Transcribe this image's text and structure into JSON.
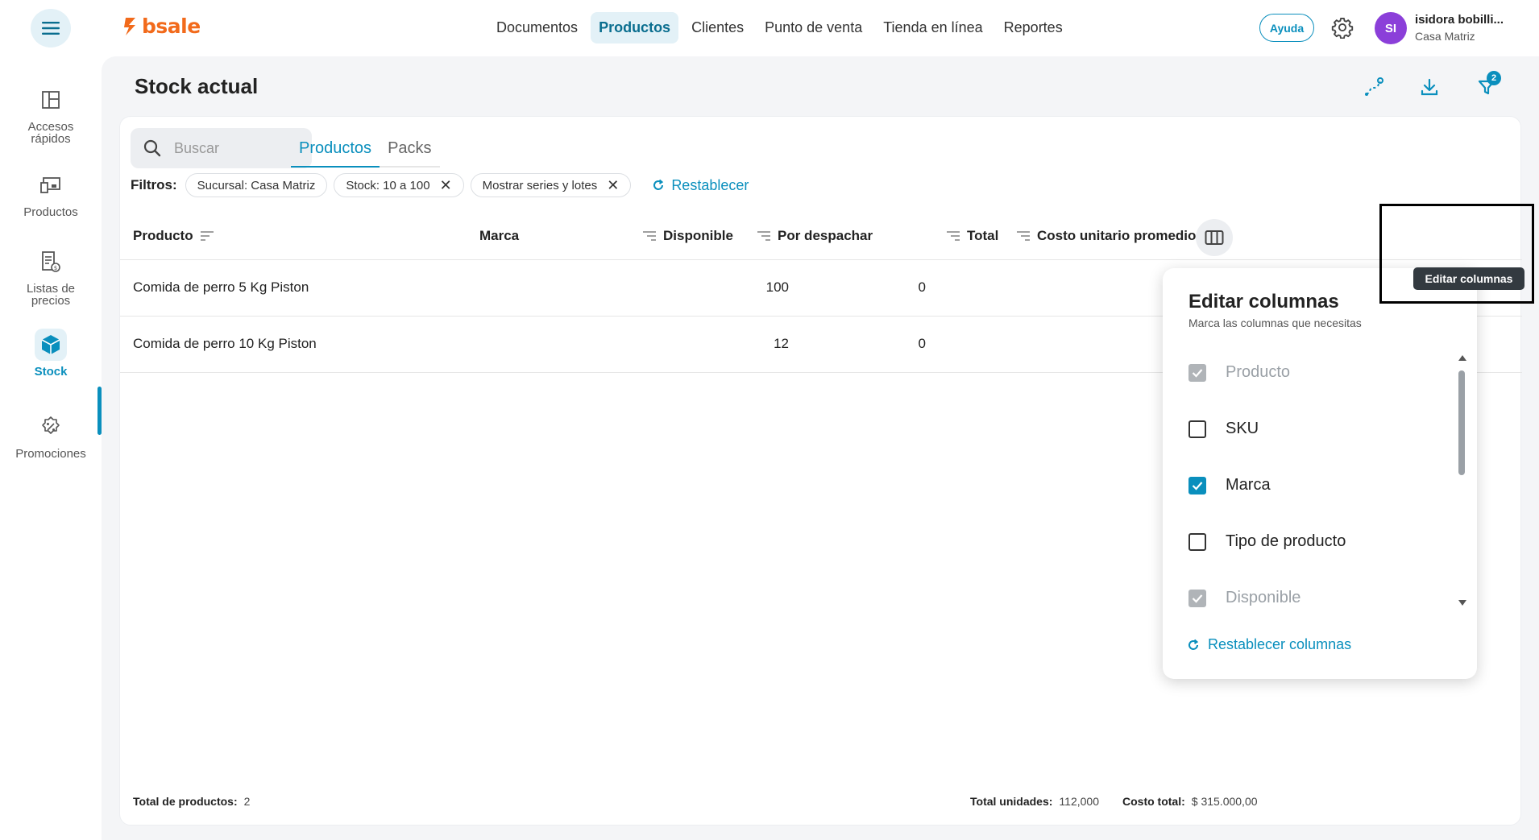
{
  "brand": {
    "name": "bsale",
    "color": "#f26a1b",
    "accent": "#0a8fbd"
  },
  "topnav": {
    "items": [
      {
        "label": "Documentos",
        "active": false
      },
      {
        "label": "Productos",
        "active": true
      },
      {
        "label": "Clientes",
        "active": false
      },
      {
        "label": "Punto de venta",
        "active": false
      },
      {
        "label": "Tienda en línea",
        "active": false
      },
      {
        "label": "Reportes",
        "active": false
      }
    ],
    "help_label": "Ayuda",
    "user": {
      "initials": "SI",
      "name": "isidora bobilli...",
      "branch": "Casa Matriz"
    }
  },
  "sidebar": {
    "items": [
      {
        "label_line1": "Accesos",
        "label_line2": "rápidos",
        "icon": "layout-icon"
      },
      {
        "label_line1": "Productos",
        "label_line2": "",
        "icon": "devices-icon"
      },
      {
        "label_line1": "Listas de",
        "label_line2": "precios",
        "icon": "price-list-icon"
      },
      {
        "label_line1": "Stock",
        "label_line2": "",
        "icon": "box-icon",
        "active": true
      },
      {
        "label_line1": "Promociones",
        "label_line2": "",
        "icon": "percent-badge-icon"
      }
    ]
  },
  "page": {
    "title": "Stock actual",
    "filter_badge_count": "2"
  },
  "search": {
    "placeholder": "Buscar",
    "value": ""
  },
  "tabs": [
    {
      "label": "Productos",
      "active": true
    },
    {
      "label": "Packs",
      "active": false
    }
  ],
  "filters": {
    "label": "Filtros:",
    "chips": [
      {
        "label": "Sucursal: Casa Matriz",
        "removable": false
      },
      {
        "label": "Stock: 10 a 100",
        "removable": true
      },
      {
        "label": "Mostrar series y lotes",
        "removable": true
      }
    ],
    "reset_label": "Restablecer"
  },
  "table": {
    "columns": {
      "producto": "Producto",
      "marca": "Marca",
      "disponible": "Disponible",
      "por_despachar": "Por despachar",
      "total": "Total",
      "costo": "Costo unitario promedio"
    },
    "rows": [
      {
        "producto": "Comida de perro 5 Kg Piston",
        "disponible": "100",
        "por_despachar": "0"
      },
      {
        "producto": "Comida de perro 10 Kg Piston",
        "disponible": "12",
        "por_despachar": "0"
      }
    ]
  },
  "footer": {
    "total_productos_label": "Total de productos:",
    "total_productos_value": "2",
    "total_unidades_label": "Total unidades:",
    "total_unidades_value": "112,000",
    "costo_total_label": "Costo total:",
    "costo_total_value": "$ 315.000,00"
  },
  "tooltip": {
    "label": "Editar columnas"
  },
  "edit_columns": {
    "title": "Editar columnas",
    "subtitle": "Marca las columnas que necesitas",
    "options": [
      {
        "label": "Producto",
        "state": "disabled-checked"
      },
      {
        "label": "SKU",
        "state": "unchecked"
      },
      {
        "label": "Marca",
        "state": "checked"
      },
      {
        "label": "Tipo de producto",
        "state": "unchecked"
      },
      {
        "label": "Disponible",
        "state": "disabled-checked"
      }
    ],
    "reset_label": "Restablecer columnas"
  }
}
